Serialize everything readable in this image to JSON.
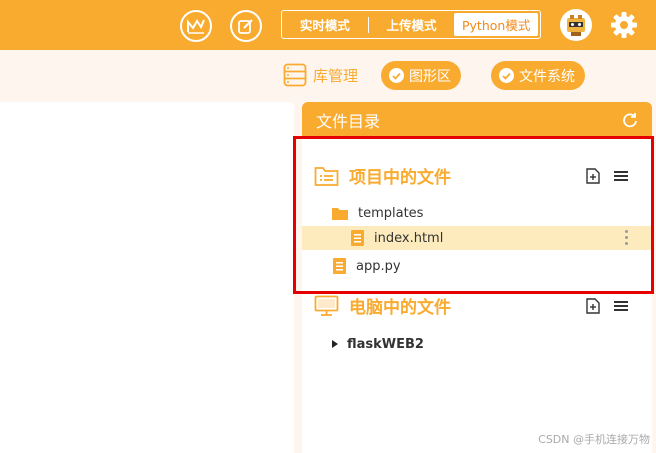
{
  "topbar": {
    "modes": [
      "实时模式",
      "上传模式",
      "Python模式"
    ],
    "active_mode": "Python模式",
    "icons": [
      "chart-circle-icon",
      "edit-circle-icon",
      "robot-avatar",
      "gear-icon"
    ]
  },
  "toolbar": {
    "library_label": "库管理",
    "graphics_label": "图形区",
    "filesystem_label": "文件系统"
  },
  "file_panel": {
    "title": "文件目录",
    "project_section": {
      "title": "项目中的文件",
      "items": [
        {
          "name": "templates",
          "type": "folder"
        },
        {
          "name": "index.html",
          "type": "file",
          "selected": true
        },
        {
          "name": "app.py",
          "type": "file"
        }
      ]
    },
    "computer_section": {
      "title": "电脑中的文件",
      "items": [
        {
          "name": "flaskWEB2",
          "type": "folder-collapsed"
        }
      ]
    }
  },
  "watermark": "CSDN @手机连接万物",
  "colors": {
    "accent": "#f9ab30",
    "highlight": "#e60000",
    "selected_row": "#fdebbd"
  }
}
